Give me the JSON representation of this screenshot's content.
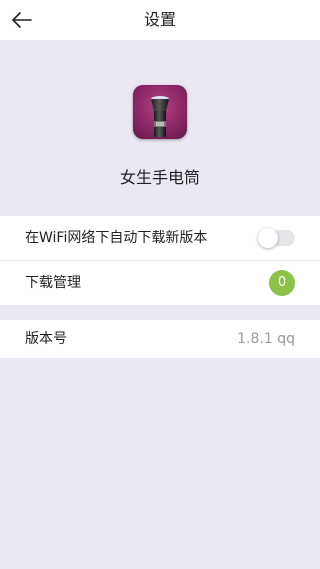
{
  "header": {
    "title": "设置",
    "back_icon": "arrow-left-icon"
  },
  "app": {
    "name": "女生手电筒",
    "icon": "flashlight-app-icon"
  },
  "settings": {
    "wifi_auto_download": {
      "label": "在WiFi网络下自动下载新版本",
      "enabled": false
    },
    "download_manager": {
      "label": "下载管理",
      "count": "0",
      "badge_color": "#8bc34a"
    },
    "version": {
      "label": "版本号",
      "value": "1.8.1  qq"
    }
  }
}
